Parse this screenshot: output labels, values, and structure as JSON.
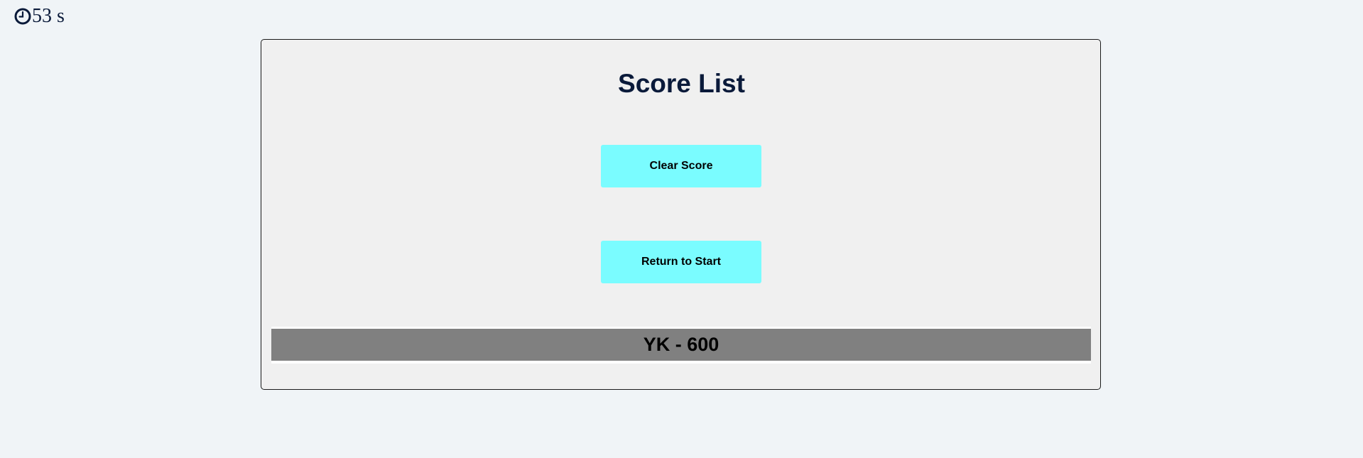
{
  "timer": {
    "icon": "clock-icon",
    "text": "53 s"
  },
  "card": {
    "title": "Score List",
    "clear_button_label": "Clear Score",
    "return_button_label": "Return to Start"
  },
  "scores": [
    {
      "text": "YK - 600"
    }
  ],
  "colors": {
    "page_background": "#f0f4f7",
    "card_background": "#f0f0f0",
    "button_background": "#7afcff",
    "title_text": "#0a1a3a",
    "score_row_background": "#808080"
  }
}
